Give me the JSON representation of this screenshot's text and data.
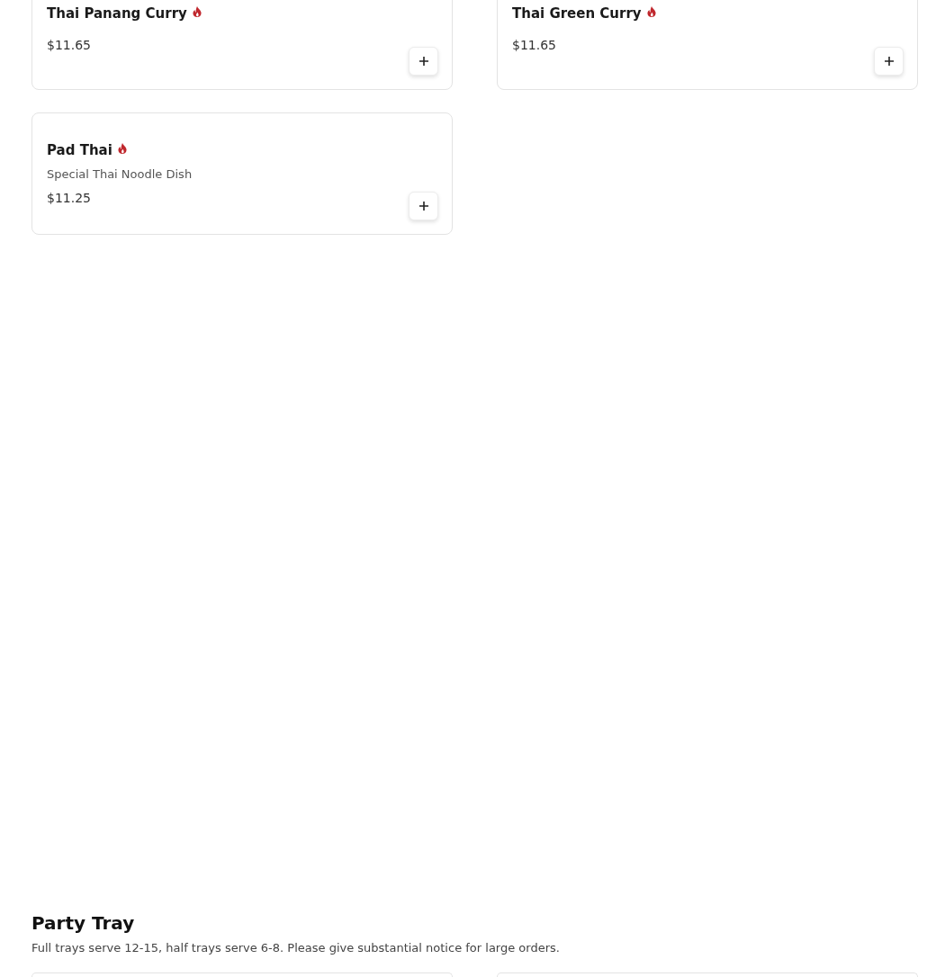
{
  "menu_section": {
    "items": [
      {
        "name": "Thai Panang Curry",
        "spicy": true,
        "price": "$11.65"
      },
      {
        "name": "Thai Green Curry",
        "spicy": true,
        "price": "$11.65"
      },
      {
        "name": "Pad Thai",
        "spicy": true,
        "description": "Special Thai Noodle Dish",
        "price": "$11.25"
      }
    ]
  },
  "party_tray": {
    "title": "Party Tray",
    "description": "Full trays serve 12-15, half trays serve 6-8. Please give substantial notice for large orders."
  }
}
